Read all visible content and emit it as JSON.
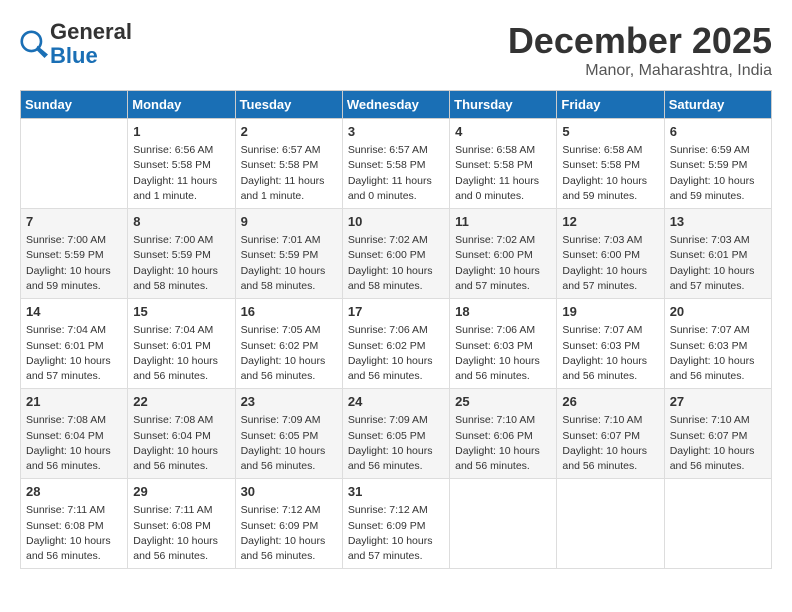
{
  "header": {
    "logo_general": "General",
    "logo_blue": "Blue",
    "month_title": "December 2025",
    "location": "Manor, Maharashtra, India"
  },
  "days_of_week": [
    "Sunday",
    "Monday",
    "Tuesday",
    "Wednesday",
    "Thursday",
    "Friday",
    "Saturday"
  ],
  "weeks": [
    [
      {
        "day": "",
        "info": ""
      },
      {
        "day": "1",
        "info": "Sunrise: 6:56 AM\nSunset: 5:58 PM\nDaylight: 11 hours\nand 1 minute."
      },
      {
        "day": "2",
        "info": "Sunrise: 6:57 AM\nSunset: 5:58 PM\nDaylight: 11 hours\nand 1 minute."
      },
      {
        "day": "3",
        "info": "Sunrise: 6:57 AM\nSunset: 5:58 PM\nDaylight: 11 hours\nand 0 minutes."
      },
      {
        "day": "4",
        "info": "Sunrise: 6:58 AM\nSunset: 5:58 PM\nDaylight: 11 hours\nand 0 minutes."
      },
      {
        "day": "5",
        "info": "Sunrise: 6:58 AM\nSunset: 5:58 PM\nDaylight: 10 hours\nand 59 minutes."
      },
      {
        "day": "6",
        "info": "Sunrise: 6:59 AM\nSunset: 5:59 PM\nDaylight: 10 hours\nand 59 minutes."
      }
    ],
    [
      {
        "day": "7",
        "info": "Sunrise: 7:00 AM\nSunset: 5:59 PM\nDaylight: 10 hours\nand 59 minutes."
      },
      {
        "day": "8",
        "info": "Sunrise: 7:00 AM\nSunset: 5:59 PM\nDaylight: 10 hours\nand 58 minutes."
      },
      {
        "day": "9",
        "info": "Sunrise: 7:01 AM\nSunset: 5:59 PM\nDaylight: 10 hours\nand 58 minutes."
      },
      {
        "day": "10",
        "info": "Sunrise: 7:02 AM\nSunset: 6:00 PM\nDaylight: 10 hours\nand 58 minutes."
      },
      {
        "day": "11",
        "info": "Sunrise: 7:02 AM\nSunset: 6:00 PM\nDaylight: 10 hours\nand 57 minutes."
      },
      {
        "day": "12",
        "info": "Sunrise: 7:03 AM\nSunset: 6:00 PM\nDaylight: 10 hours\nand 57 minutes."
      },
      {
        "day": "13",
        "info": "Sunrise: 7:03 AM\nSunset: 6:01 PM\nDaylight: 10 hours\nand 57 minutes."
      }
    ],
    [
      {
        "day": "14",
        "info": "Sunrise: 7:04 AM\nSunset: 6:01 PM\nDaylight: 10 hours\nand 57 minutes."
      },
      {
        "day": "15",
        "info": "Sunrise: 7:04 AM\nSunset: 6:01 PM\nDaylight: 10 hours\nand 56 minutes."
      },
      {
        "day": "16",
        "info": "Sunrise: 7:05 AM\nSunset: 6:02 PM\nDaylight: 10 hours\nand 56 minutes."
      },
      {
        "day": "17",
        "info": "Sunrise: 7:06 AM\nSunset: 6:02 PM\nDaylight: 10 hours\nand 56 minutes."
      },
      {
        "day": "18",
        "info": "Sunrise: 7:06 AM\nSunset: 6:03 PM\nDaylight: 10 hours\nand 56 minutes."
      },
      {
        "day": "19",
        "info": "Sunrise: 7:07 AM\nSunset: 6:03 PM\nDaylight: 10 hours\nand 56 minutes."
      },
      {
        "day": "20",
        "info": "Sunrise: 7:07 AM\nSunset: 6:03 PM\nDaylight: 10 hours\nand 56 minutes."
      }
    ],
    [
      {
        "day": "21",
        "info": "Sunrise: 7:08 AM\nSunset: 6:04 PM\nDaylight: 10 hours\nand 56 minutes."
      },
      {
        "day": "22",
        "info": "Sunrise: 7:08 AM\nSunset: 6:04 PM\nDaylight: 10 hours\nand 56 minutes."
      },
      {
        "day": "23",
        "info": "Sunrise: 7:09 AM\nSunset: 6:05 PM\nDaylight: 10 hours\nand 56 minutes."
      },
      {
        "day": "24",
        "info": "Sunrise: 7:09 AM\nSunset: 6:05 PM\nDaylight: 10 hours\nand 56 minutes."
      },
      {
        "day": "25",
        "info": "Sunrise: 7:10 AM\nSunset: 6:06 PM\nDaylight: 10 hours\nand 56 minutes."
      },
      {
        "day": "26",
        "info": "Sunrise: 7:10 AM\nSunset: 6:07 PM\nDaylight: 10 hours\nand 56 minutes."
      },
      {
        "day": "27",
        "info": "Sunrise: 7:10 AM\nSunset: 6:07 PM\nDaylight: 10 hours\nand 56 minutes."
      }
    ],
    [
      {
        "day": "28",
        "info": "Sunrise: 7:11 AM\nSunset: 6:08 PM\nDaylight: 10 hours\nand 56 minutes."
      },
      {
        "day": "29",
        "info": "Sunrise: 7:11 AM\nSunset: 6:08 PM\nDaylight: 10 hours\nand 56 minutes."
      },
      {
        "day": "30",
        "info": "Sunrise: 7:12 AM\nSunset: 6:09 PM\nDaylight: 10 hours\nand 56 minutes."
      },
      {
        "day": "31",
        "info": "Sunrise: 7:12 AM\nSunset: 6:09 PM\nDaylight: 10 hours\nand 57 minutes."
      },
      {
        "day": "",
        "info": ""
      },
      {
        "day": "",
        "info": ""
      },
      {
        "day": "",
        "info": ""
      }
    ]
  ]
}
